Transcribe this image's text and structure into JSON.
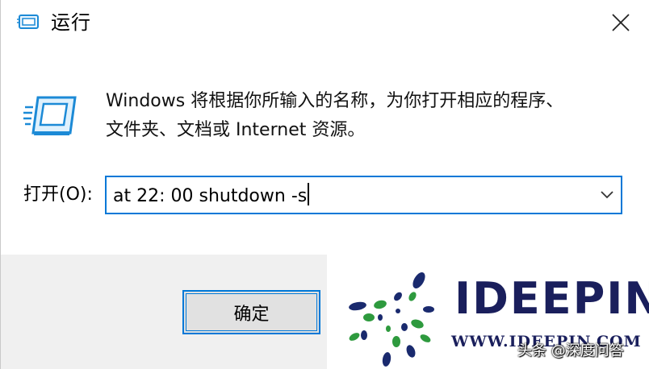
{
  "window": {
    "title": "运行",
    "close_icon": "close-icon"
  },
  "description": {
    "line1": "Windows 将根据你所输入的名称，为你打开相应的程序、",
    "line2": "文件夹、文档或 Internet 资源。"
  },
  "open_field": {
    "label": "打开(O):",
    "value": "at 22: 00 shutdown -s",
    "dropdown_icon": "chevron-down-icon"
  },
  "buttons": {
    "ok_label": "确定"
  },
  "watermark": {
    "brand": "IDEEPIN",
    "url": "WWW.IDEEPIN.COM",
    "credit": "头条 @深度问答"
  },
  "colors": {
    "accent": "#0078d7",
    "footer_bg": "#f0f0f0",
    "brand_navy": "#1a1f5c",
    "logo_green": "#2e9a3e"
  }
}
